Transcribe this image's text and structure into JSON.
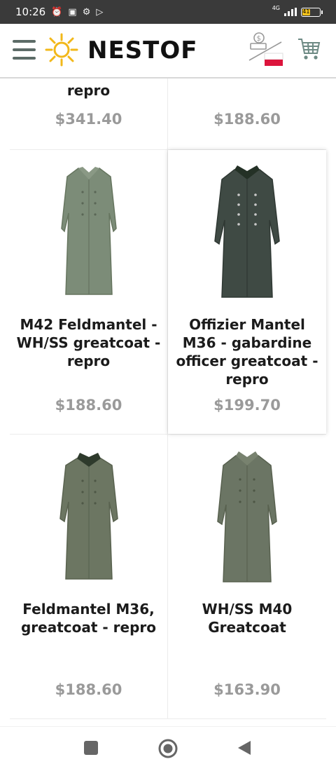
{
  "status_bar": {
    "time": "10:26",
    "network_label": "4G",
    "battery_level": "41"
  },
  "header": {
    "brand": "NESTOF",
    "icons": {
      "menu": "hamburger-menu-icon",
      "logo": "sun-logo-icon",
      "currency": "currency-flag-icon",
      "cart": "shopping-cart-icon"
    },
    "flag_colors": [
      "#ffffff",
      "#dc143c"
    ]
  },
  "products": {
    "top_row": [
      {
        "title": "repro",
        "price": "$341.40"
      },
      {
        "title": "",
        "price": "$188.60"
      }
    ],
    "rows": [
      [
        {
          "title": "M42 Feldmantel - WH/SS greatcoat - repro",
          "price": "$188.60",
          "image": "grey-green-greatcoat"
        },
        {
          "title": "Offizier Mantel M36 - gabardine officer greatcoat - repro",
          "price": "$199.70",
          "image": "dark-officer-greatcoat"
        }
      ],
      [
        {
          "title": "Feldmantel M36, greatcoat - repro",
          "price": "$188.60",
          "image": "field-greatcoat-dark-collar"
        },
        {
          "title": "WH/SS M40 Greatcoat",
          "price": "$163.90",
          "image": "m40-greatcoat"
        }
      ]
    ]
  },
  "nav_bar": {
    "recents": "recents-square-icon",
    "home": "home-circle-icon",
    "back": "back-triangle-icon"
  },
  "colors": {
    "price": "#9a9a9a",
    "status_bar": "#3a3a3a",
    "logo_sun": "#f2b81a"
  }
}
